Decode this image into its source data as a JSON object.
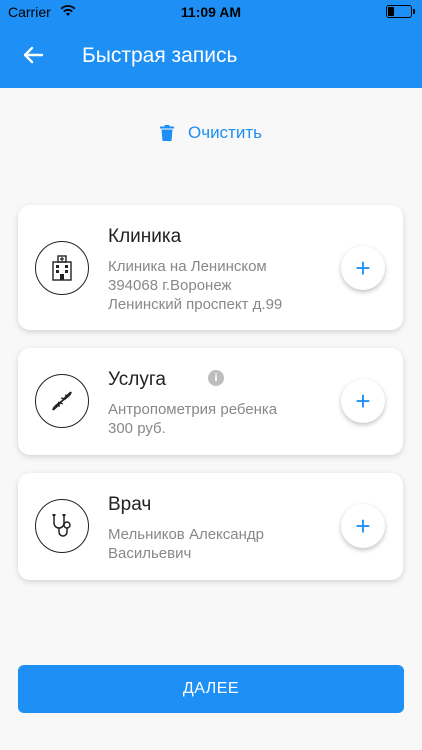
{
  "status": {
    "carrier": "Carrier",
    "time": "11:09 AM"
  },
  "header": {
    "title": "Быстрая запись"
  },
  "clear": {
    "label": "Очистить"
  },
  "cards": [
    {
      "title": "Клиника",
      "lines": [
        "Клиника на Ленинском",
        "394068 г.Воронеж",
        "Ленинский проспект д.99"
      ]
    },
    {
      "title": "Услуга",
      "lines": [
        "Антропометрия ребенка",
        "300 руб."
      ]
    },
    {
      "title": "Врач",
      "lines": [
        "Мельников Александр",
        "Васильевич"
      ]
    }
  ],
  "plus_label": "+",
  "info_label": "i",
  "next": {
    "label": "ДАЛЕЕ"
  },
  "colors": {
    "accent": "#1e90f5",
    "background": "#f8f8f8"
  },
  "icons": [
    "back-arrow-icon",
    "trash-icon",
    "clinic-building-icon",
    "dna-icon",
    "stethoscope-icon",
    "info-icon",
    "plus-icon"
  ]
}
